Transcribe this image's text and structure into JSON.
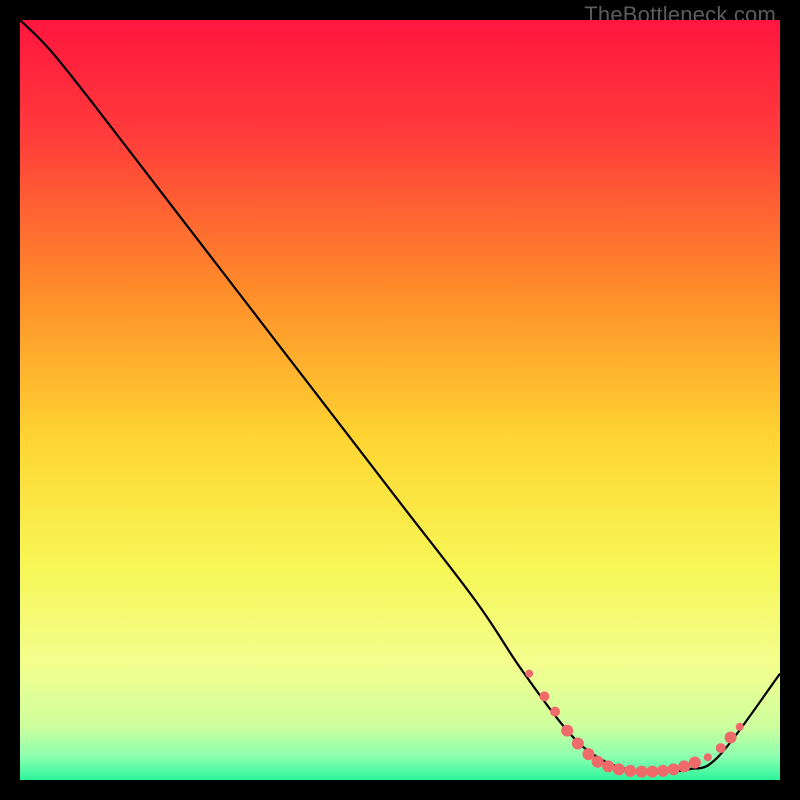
{
  "watermark": "TheBottleneck.com",
  "chart_data": {
    "type": "line",
    "title": "",
    "xlabel": "",
    "ylabel": "",
    "xlim": [
      0,
      100
    ],
    "ylim": [
      0,
      100
    ],
    "grid": false,
    "legend": false,
    "background_gradient": {
      "stops": [
        {
          "offset": 0.0,
          "color": "#ff163f"
        },
        {
          "offset": 0.15,
          "color": "#ff3b3b"
        },
        {
          "offset": 0.35,
          "color": "#ff8a2a"
        },
        {
          "offset": 0.55,
          "color": "#ffd531"
        },
        {
          "offset": 0.72,
          "color": "#f7f756"
        },
        {
          "offset": 0.85,
          "color": "#f3fe8f"
        },
        {
          "offset": 0.93,
          "color": "#cdff9e"
        },
        {
          "offset": 0.97,
          "color": "#8bffb0"
        },
        {
          "offset": 1.0,
          "color": "#2cf59c"
        }
      ]
    },
    "series": [
      {
        "name": "bottleneck-curve",
        "color": "#000000",
        "x": [
          0,
          4,
          10,
          20,
          30,
          40,
          50,
          60,
          66,
          72,
          76,
          80,
          84,
          88,
          92,
          100
        ],
        "y": [
          100,
          96,
          88.5,
          75.5,
          62.5,
          49.5,
          36.5,
          23.5,
          14.5,
          6.5,
          3.0,
          1.4,
          1.1,
          1.4,
          3.2,
          14.0
        ]
      }
    ],
    "markers": {
      "name": "optimum-zone",
      "color": "#ef6a6a",
      "shape": "circle",
      "points": [
        {
          "x": 67.0,
          "y": 14.0,
          "r": 4
        },
        {
          "x": 69.0,
          "y": 11.0,
          "r": 5
        },
        {
          "x": 70.4,
          "y": 9.0,
          "r": 5
        },
        {
          "x": 72.0,
          "y": 6.5,
          "r": 6
        },
        {
          "x": 73.4,
          "y": 4.8,
          "r": 6
        },
        {
          "x": 74.8,
          "y": 3.4,
          "r": 6
        },
        {
          "x": 76.0,
          "y": 2.4,
          "r": 6
        },
        {
          "x": 77.4,
          "y": 1.8,
          "r": 6
        },
        {
          "x": 78.8,
          "y": 1.4,
          "r": 6
        },
        {
          "x": 80.3,
          "y": 1.2,
          "r": 6
        },
        {
          "x": 81.8,
          "y": 1.1,
          "r": 6
        },
        {
          "x": 83.2,
          "y": 1.1,
          "r": 6
        },
        {
          "x": 84.6,
          "y": 1.2,
          "r": 6
        },
        {
          "x": 86.0,
          "y": 1.4,
          "r": 6
        },
        {
          "x": 87.4,
          "y": 1.8,
          "r": 6
        },
        {
          "x": 88.8,
          "y": 2.3,
          "r": 6
        },
        {
          "x": 90.5,
          "y": 3.0,
          "r": 4
        },
        {
          "x": 92.2,
          "y": 4.2,
          "r": 5
        },
        {
          "x": 93.5,
          "y": 5.6,
          "r": 6
        },
        {
          "x": 94.7,
          "y": 7.0,
          "r": 4
        }
      ]
    }
  }
}
